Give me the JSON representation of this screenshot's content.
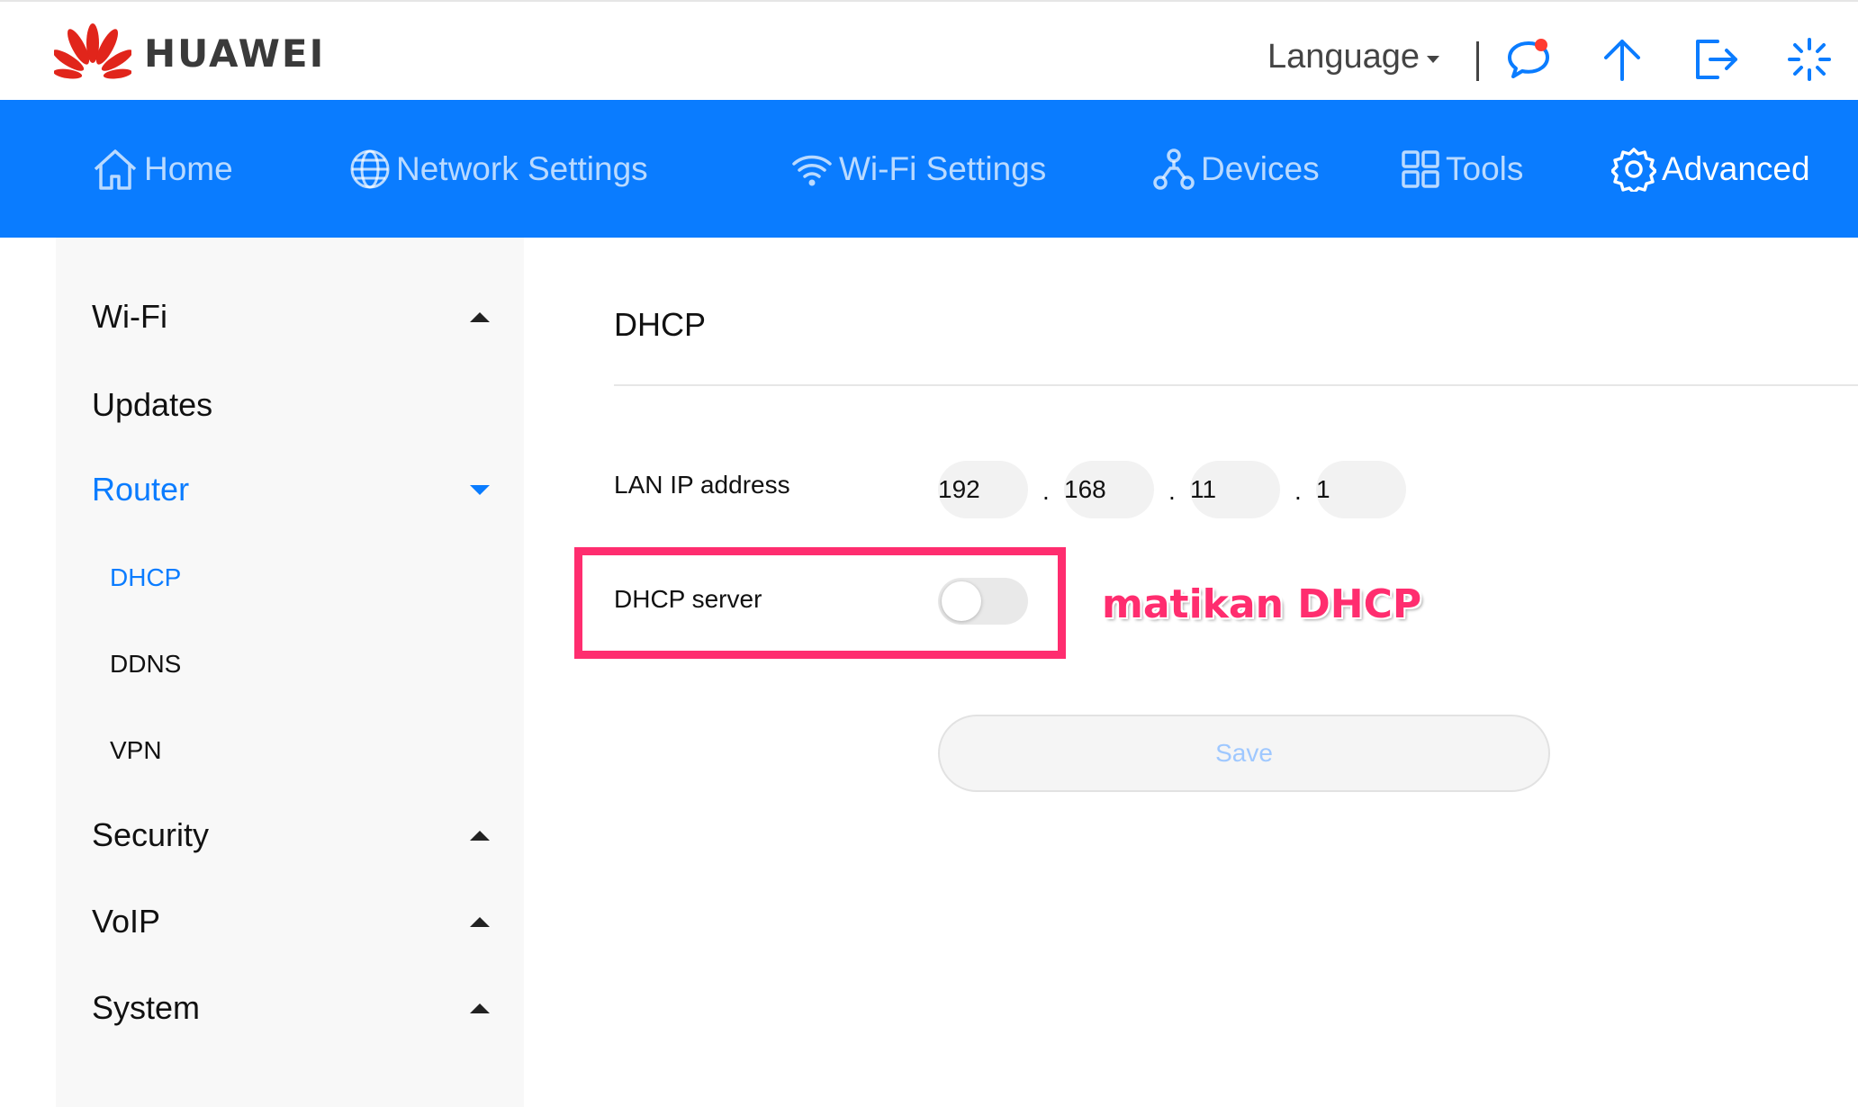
{
  "header": {
    "brand": "HUAWEI",
    "language_label": "Language",
    "icons": [
      "messages-icon",
      "upload-icon",
      "logout-icon",
      "loading-icon"
    ]
  },
  "nav": {
    "items": [
      {
        "label": "Home",
        "icon": "home-icon"
      },
      {
        "label": "Network Settings",
        "icon": "globe-icon"
      },
      {
        "label": "Wi-Fi Settings",
        "icon": "wifi-icon"
      },
      {
        "label": "Devices",
        "icon": "devices-icon"
      },
      {
        "label": "Tools",
        "icon": "tools-icon"
      },
      {
        "label": "Advanced",
        "icon": "gear-icon",
        "active": true
      }
    ]
  },
  "sidebar": {
    "items": [
      {
        "label": "Wi-Fi",
        "expanded": false
      },
      {
        "label": "Updates"
      },
      {
        "label": "Router",
        "expanded": true,
        "active": true
      },
      {
        "label": "Security",
        "expanded": false
      },
      {
        "label": "VoIP",
        "expanded": false
      },
      {
        "label": "System",
        "expanded": false
      }
    ],
    "router_sub": [
      {
        "label": "DHCP",
        "active": true
      },
      {
        "label": "DDNS"
      },
      {
        "label": "VPN"
      }
    ]
  },
  "main": {
    "title": "DHCP",
    "lan_ip_label": "LAN IP address",
    "lan_ip": [
      "192",
      "168",
      "11",
      "1"
    ],
    "dot": ".",
    "dhcp_server_label": "DHCP server",
    "dhcp_server_enabled": false,
    "save_label": "Save"
  },
  "annotation": {
    "text": "matikan DHCP",
    "color": "#ff2d6f"
  },
  "colors": {
    "accent": "#0a7cff",
    "brand_red": "#e1251b",
    "highlight": "#ff2d6f"
  }
}
